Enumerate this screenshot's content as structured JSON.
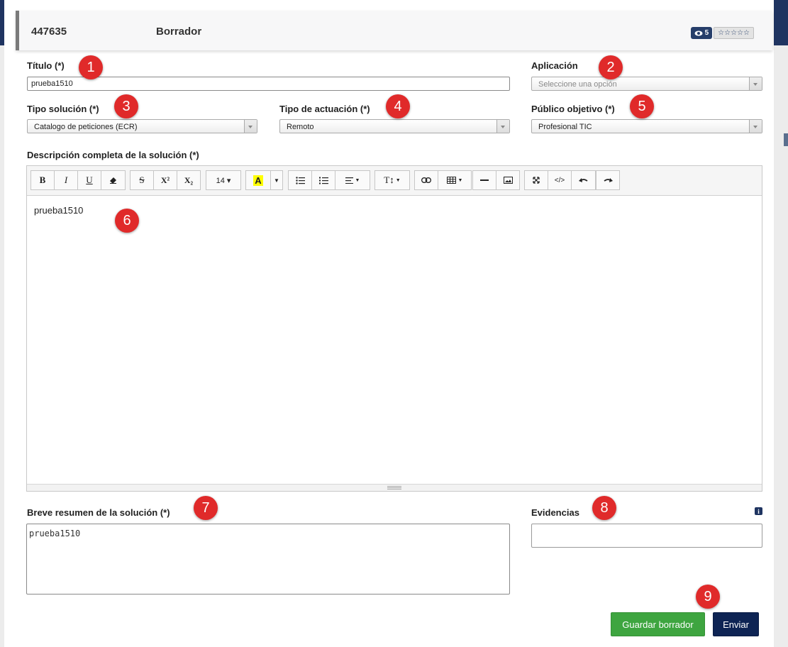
{
  "header": {
    "id": "447635",
    "status": "Borrador",
    "views": "5",
    "rating": "☆☆☆☆☆"
  },
  "form": {
    "titulo": {
      "label": "Título (*)",
      "value": "prueba1510"
    },
    "aplicacion": {
      "label": "Aplicación",
      "placeholder": "Seleccione una opción"
    },
    "tipo_solucion": {
      "label": "Tipo solución (*)",
      "value": "Catalogo de peticiones (ECR)"
    },
    "tipo_actuacion": {
      "label": "Tipo de actuación (*)",
      "value": "Remoto"
    },
    "publico_objetivo": {
      "label": "Público objetivo (*)",
      "value": "Profesional TIC"
    },
    "descripcion": {
      "label": "Descripción completa de la solución (*)",
      "value": "prueba1510"
    },
    "resumen": {
      "label": "Breve resumen de la solución (*)",
      "value": "prueba1510"
    },
    "evidencias": {
      "label": "Evidencias"
    }
  },
  "toolbar": {
    "bold": "B",
    "italic": "I",
    "underline": "U",
    "strike": "S",
    "superscript": "X²",
    "subscript": "X₂",
    "font_size": "14 ▾",
    "highlight": "A",
    "code": "</>"
  },
  "markers": [
    "1",
    "2",
    "3",
    "4",
    "5",
    "6",
    "7",
    "8",
    "9"
  ],
  "buttons": {
    "save": "Guardar borrador",
    "send": "Enviar"
  },
  "colors": {
    "primary": "#0e2454",
    "success": "#3ea540",
    "marker": "#e02a2a"
  }
}
